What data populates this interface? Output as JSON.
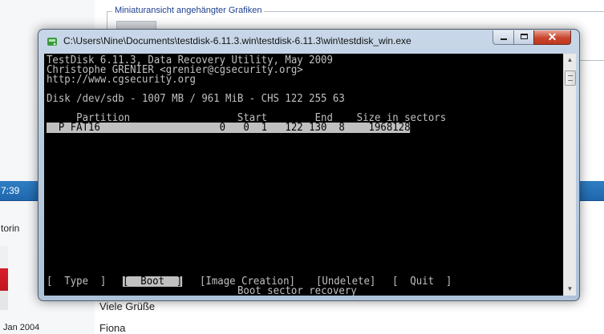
{
  "background": {
    "fieldset_legend": "Miniaturansicht angehängter Grafiken",
    "bar_time": "7:39",
    "user_name": "torin",
    "date": "Jan 2004",
    "post_greeting": "Viele Grüße",
    "post_signature": "Fiona"
  },
  "window": {
    "title": "C:\\Users\\Nine\\Documents\\testdisk-6.11.3.win\\testdisk-6.11.3\\win\\testdisk_win.exe",
    "close_glyph": "✕"
  },
  "console": {
    "header_line1": "TestDisk 6.11.3, Data Recovery Utility, May 2009",
    "header_line2": "Christophe GRENIER <grenier@cgsecurity.org>",
    "header_line3": "http://www.cgsecurity.org",
    "disk_line": "Disk /dev/sdb - 1007 MB / 961 MiB - CHS 122 255 63",
    "column_headers": "     Partition                  Start        End    Size in sectors",
    "partition_row": "  P FAT16                    0   0  1   122 130  8    1968128",
    "menu": {
      "type": "[  Type  ]",
      "boot": "[  Boot  ]",
      "image_creation": "[Image Creation]",
      "undelete": "[Undelete]",
      "quit": "[  Quit  ]"
    },
    "status": "Boot sector recovery"
  },
  "icons": {
    "app": "testdisk-app-icon",
    "minimize": "minimize-icon",
    "maximize": "maximize-icon",
    "close": "close-icon"
  },
  "colors": {
    "console_bg": "#000000",
    "console_fg": "#c0c0c0",
    "highlight_bg": "#c0c0c0",
    "title_bar": "#b9cde2",
    "close_button": "#c8452d",
    "forum_bar": "#2373b9"
  }
}
